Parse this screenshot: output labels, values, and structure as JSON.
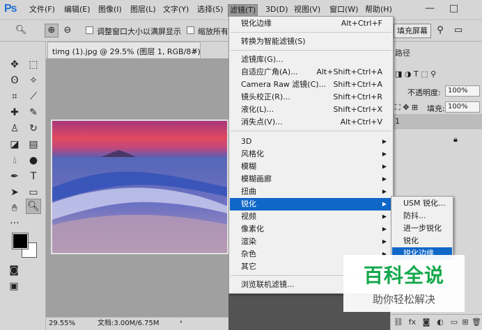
{
  "app": {
    "logo": "Ps"
  },
  "menubar": {
    "items": [
      "文件(F)",
      "编辑(E)",
      "图像(I)",
      "图层(L)",
      "文字(Y)",
      "选择(S)",
      "滤镜(T)",
      "3D(D)",
      "视图(V)",
      "窗口(W)",
      "帮助(H)"
    ],
    "window_controls": [
      "—",
      "□"
    ]
  },
  "options_bar": {
    "resize_windows_label": "调整窗口大小以满屏显示",
    "zoom_all_windows_label": "缩放所有",
    "fill_screen_button": "填充屏幕"
  },
  "document": {
    "tab_title": "timg (1).jpg @ 29.5% (图层 1, RGB/8#) *",
    "tab_close": "×",
    "status_zoom": "29.55%",
    "status_doc": "文档:3.00M/6.75M",
    "status_arrow": "›"
  },
  "panel": {
    "tab_label": "路径",
    "opacity_label": "不透明度:",
    "opacity_value": "100%",
    "fill_label": "填充:",
    "fill_value": "100%",
    "layer_number": "1"
  },
  "filter_menu": {
    "items": [
      {
        "label": "锐化边缘",
        "shortcut": "Alt+Ctrl+F"
      },
      {
        "label": "转换为智能滤镜(S)",
        "shortcut": ""
      },
      {
        "label": "滤镜库(G)...",
        "shortcut": ""
      },
      {
        "label": "自适应广角(A)...",
        "shortcut": "Alt+Shift+Ctrl+A"
      },
      {
        "label": "Camera Raw 滤镜(C)...",
        "shortcut": "Shift+Ctrl+A"
      },
      {
        "label": "镜头校正(R)...",
        "shortcut": "Shift+Ctrl+R"
      },
      {
        "label": "液化(L)...",
        "shortcut": "Shift+Ctrl+X"
      },
      {
        "label": "消失点(V)...",
        "shortcut": "Alt+Ctrl+V"
      },
      {
        "label": "3D",
        "shortcut": ""
      },
      {
        "label": "风格化",
        "shortcut": ""
      },
      {
        "label": "模糊",
        "shortcut": ""
      },
      {
        "label": "模糊画廊",
        "shortcut": ""
      },
      {
        "label": "扭曲",
        "shortcut": ""
      },
      {
        "label": "锐化",
        "shortcut": ""
      },
      {
        "label": "视频",
        "shortcut": ""
      },
      {
        "label": "像素化",
        "shortcut": ""
      },
      {
        "label": "渲染",
        "shortcut": ""
      },
      {
        "label": "杂色",
        "shortcut": ""
      },
      {
        "label": "其它",
        "shortcut": ""
      },
      {
        "label": "浏览联机滤镜...",
        "shortcut": ""
      }
    ]
  },
  "sharpen_submenu": {
    "items": [
      "USM 锐化...",
      "防抖...",
      "进一步锐化",
      "锐化",
      "锐化边缘"
    ]
  },
  "watermark": {
    "title": "百科全说",
    "subtitle": "助你轻松解决"
  },
  "colors": {
    "highlight": "#0f67c8",
    "watermark_green": "#13a84b",
    "ps_blue": "#1f6fd1"
  }
}
